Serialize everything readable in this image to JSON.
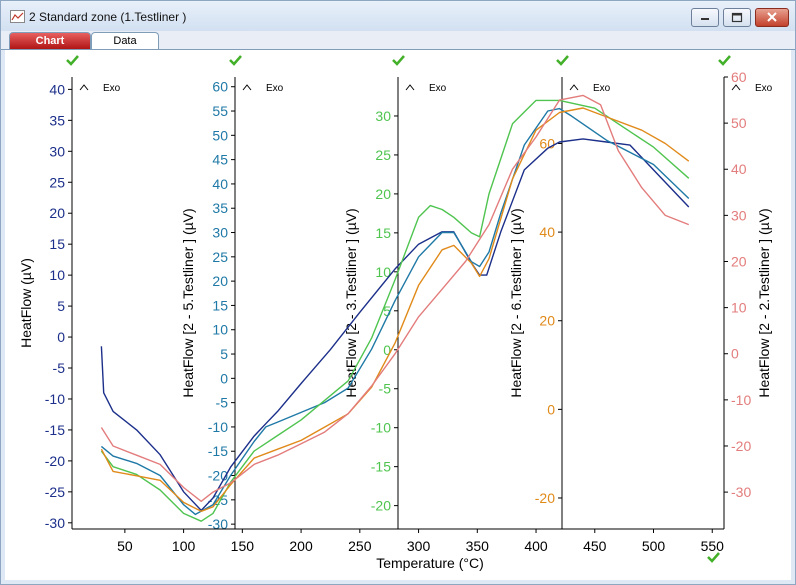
{
  "window": {
    "title": "2 Standard zone (1.Testliner )"
  },
  "tabs": [
    {
      "label": "Chart",
      "active": true
    },
    {
      "label": "Data",
      "active": false
    }
  ],
  "chart_data": {
    "type": "line",
    "xlabel": "Temperature (°C)",
    "x_ticks": [
      50,
      100,
      150,
      200,
      250,
      300,
      350,
      400,
      450,
      500,
      550
    ],
    "xlim": [
      5,
      560
    ],
    "exo_label": "Exo",
    "axes": [
      {
        "ylabel": "HeatFlow (µV)",
        "ylim": [
          -31,
          42
        ],
        "ticks": [
          40,
          35,
          30,
          25,
          20,
          15,
          10,
          5,
          0,
          -5,
          -10,
          -15,
          -20,
          -25,
          -30
        ],
        "color": "#1c2f8a"
      },
      {
        "ylabel": "HeatFlow [2 - 5.Testliner ] (µV)",
        "ylim": [
          -31,
          62
        ],
        "ticks": [
          60,
          55,
          50,
          45,
          40,
          35,
          30,
          25,
          20,
          15,
          10,
          5,
          0,
          -5,
          -10,
          -15,
          -20,
          -25,
          -30
        ],
        "color": "#1f79a6"
      },
      {
        "ylabel": "HeatFlow [2 - 3.Testliner ] (µV)",
        "ylim": [
          -23,
          35
        ],
        "ticks": [
          30,
          25,
          20,
          15,
          10,
          5,
          0,
          -5,
          -10,
          -15,
          -20
        ],
        "color": "#4fc44f"
      },
      {
        "ylabel": "HeatFlow [2 - 6.Testliner ] (µV)",
        "ylim": [
          -27,
          75
        ],
        "ticks": [
          60,
          40,
          20,
          0,
          -20
        ],
        "color": "#e08a1a"
      },
      {
        "ylabel": "HeatFlow [2 - 2.Testliner ] (µV)",
        "ylim": [
          -38,
          60
        ],
        "ticks": [
          60,
          50,
          40,
          30,
          20,
          10,
          0,
          -10,
          -20,
          -30
        ],
        "color": "#e37c7c"
      }
    ],
    "series": [
      {
        "color": "#1c2f8a",
        "x": [
          30,
          32,
          40,
          60,
          80,
          100,
          115,
          125,
          140,
          160,
          170,
          180,
          200,
          225,
          250,
          280,
          300,
          320,
          330,
          345,
          352,
          358,
          370,
          390,
          410,
          420,
          440,
          460,
          480,
          500,
          530
        ],
        "y": [
          -1.5,
          -9,
          -12,
          -15,
          -19,
          -25,
          -28,
          -26,
          -21,
          -16,
          -14,
          -12,
          -7.5,
          -2,
          4,
          11,
          15,
          17,
          17,
          12,
          10,
          10,
          17,
          27,
          30.5,
          31.5,
          32,
          31.5,
          31,
          27,
          21
        ]
      },
      {
        "color": "#1f79a6",
        "x": [
          30,
          40,
          60,
          80,
          100,
          110,
          125,
          140,
          160,
          170,
          180,
          200,
          220,
          240,
          260,
          280,
          300,
          320,
          330,
          345,
          352,
          360,
          370,
          390,
          410,
          420,
          430,
          460,
          500,
          530
        ],
        "y": [
          -14,
          -16,
          -17.5,
          -20,
          -26,
          -28,
          -26,
          -20,
          -13,
          -10,
          -9,
          -7,
          -5,
          -2,
          6,
          16,
          25,
          30,
          30,
          24,
          23,
          26,
          34,
          48,
          55,
          55.5,
          54,
          49,
          44,
          37
        ]
      },
      {
        "color": "#4fc44f",
        "x": [
          30,
          40,
          60,
          80,
          100,
          115,
          125,
          140,
          160,
          180,
          200,
          220,
          240,
          260,
          280,
          300,
          310,
          320,
          330,
          345,
          352,
          360,
          380,
          400,
          420,
          450,
          480,
          500,
          530
        ],
        "y": [
          -13,
          -15,
          -16,
          -18,
          -21,
          -22,
          -21,
          -17,
          -13,
          -11,
          -9,
          -6.5,
          -4,
          1.5,
          9,
          17,
          18.5,
          18,
          17,
          15,
          14.5,
          20,
          29,
          32,
          32,
          31,
          28,
          26,
          22
        ]
      },
      {
        "color": "#e08a1a",
        "x": [
          30,
          40,
          60,
          80,
          100,
          115,
          125,
          140,
          160,
          180,
          200,
          220,
          240,
          260,
          280,
          300,
          320,
          330,
          345,
          352,
          360,
          380,
          400,
          420,
          440,
          460,
          490,
          510,
          530
        ],
        "y": [
          -9,
          -14,
          -15,
          -16,
          -21,
          -23,
          -22,
          -17,
          -11,
          -9,
          -7,
          -4,
          -1,
          5,
          15,
          28,
          36,
          37,
          33,
          30,
          34,
          52,
          63,
          67,
          68,
          66,
          63,
          60,
          56
        ]
      },
      {
        "color": "#e37c7c",
        "x": [
          30,
          40,
          60,
          80,
          100,
          115,
          125,
          140,
          160,
          180,
          200,
          220,
          240,
          260,
          280,
          300,
          320,
          340,
          360,
          380,
          400,
          420,
          440,
          455,
          470,
          490,
          510,
          530
        ],
        "y": [
          -16,
          -20,
          -22,
          -24,
          -29,
          -32,
          -30,
          -28,
          -24,
          -22,
          -19.5,
          -17,
          -13,
          -7,
          0,
          8,
          14,
          20,
          28,
          40,
          47,
          55,
          56,
          54,
          44,
          36,
          30,
          28
        ]
      }
    ]
  }
}
